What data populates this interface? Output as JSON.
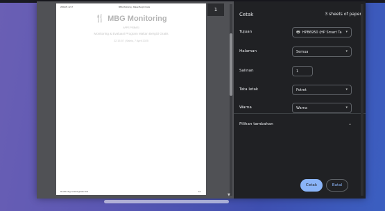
{
  "preview": {
    "page_number": "1",
    "paper": {
      "header_left": "20/04/25, 22:17",
      "header_center": "MBG Monitoring - Makan Bergizi Gratis",
      "logo_icon": "utensils-icon",
      "title": "MBG Monitoring",
      "subtitle": "APPS PISBASI",
      "program": "Monitoring & Evaluasi Program Makan Bergizi Gratis",
      "datetime": "22.15.57 | Sabtu, 7 April 2025",
      "footer_left": "file:///D:/mbg-monitoring/index.html",
      "footer_right": "1/1"
    }
  },
  "settings": {
    "title": "Cetak",
    "sheet_count": "3 sheets of paper",
    "destination": {
      "label": "Tujuan",
      "value": "HPB6950 (HP Smart Ta",
      "icon": "printer-icon"
    },
    "pages": {
      "label": "Halaman",
      "value": "Semua"
    },
    "copies": {
      "label": "Salinan",
      "value": "1"
    },
    "layout": {
      "label": "Tata letak",
      "value": "Potret"
    },
    "color": {
      "label": "Warna",
      "value": "Warna"
    },
    "more_settings": "Pilihan tambahan"
  },
  "buttons": {
    "print": "Cetak",
    "cancel": "Batal"
  },
  "colors": {
    "accent": "#8ab4f8",
    "dialog_bg": "#202124",
    "preview_bg": "#505155"
  }
}
